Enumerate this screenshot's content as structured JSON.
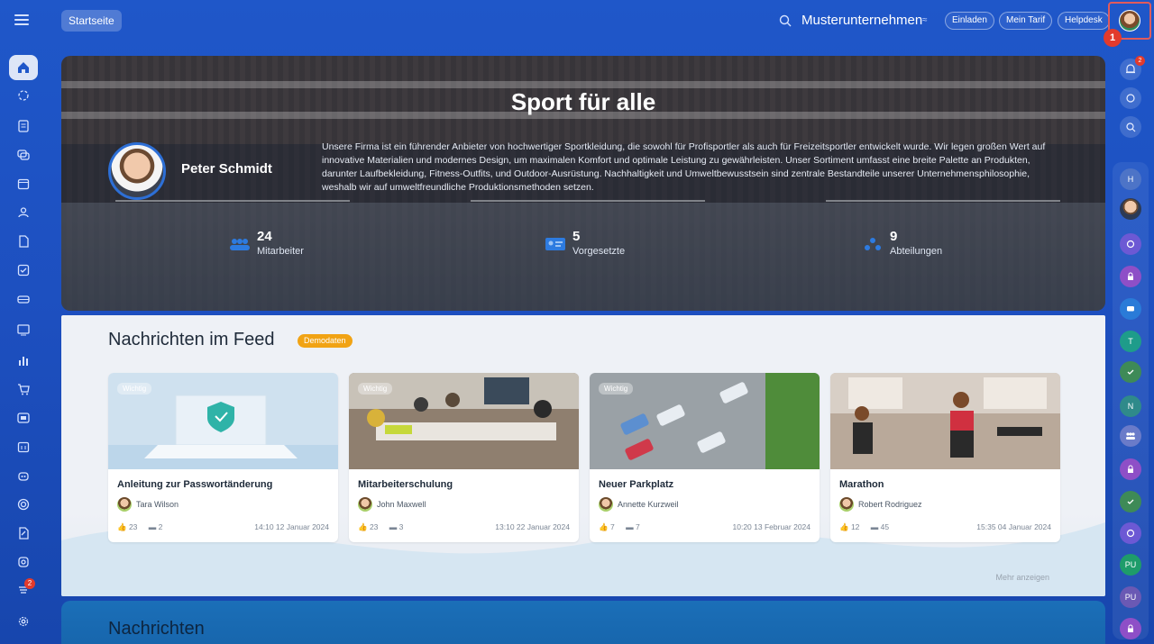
{
  "topbar": {
    "home_label": "Startseite",
    "company_name": "Musterunternehmen",
    "swap_symbol": "≈",
    "buttons": [
      "Einladen",
      "Mein Tarif",
      "Helpdesk"
    ],
    "marker": "1"
  },
  "left_nav": {
    "items": [
      "home-icon",
      "activity-icon",
      "tasks-icon",
      "chat-icon",
      "calendar-icon",
      "groups-icon",
      "documents-icon",
      "checklist-icon",
      "drive-icon",
      "presentation-icon",
      "analytics-icon",
      "shop-icon",
      "crm-icon",
      "scheduler-icon",
      "robot-icon",
      "target-icon",
      "sign-icon",
      "marketplace-icon",
      "sites-icon",
      "settings-icon"
    ],
    "badge": "2"
  },
  "right_nav": {
    "notif_badge": "2",
    "bubbles": [
      "H",
      "",
      "",
      "",
      "",
      "",
      "T",
      "",
      "N",
      "",
      "",
      "",
      "",
      "PU",
      "PU",
      ""
    ]
  },
  "hero": {
    "title": "Sport für alle",
    "person_name": "Peter Schmidt",
    "description": "Unsere Firma ist ein führender Anbieter von hochwertiger Sportkleidung, die sowohl für Profisportler als auch für Freizeitsportler entwickelt wurde. Wir legen großen Wert auf innovative Materialien und modernes Design, um maximalen Komfort und optimale Leistung zu gewährleisten. Unser Sortiment umfasst eine breite Palette an Produkten, darunter Laufbekleidung, Fitness-Outfits, und Outdoor-Ausrüstung. Nachhaltigkeit und Umweltbewusstsein sind zentrale Bestandteile unserer Unternehmensphilosophie, weshalb wir auf umweltfreundliche Produktionsmethoden setzen.",
    "stats": [
      {
        "value": "24",
        "label": "Mitarbeiter"
      },
      {
        "value": "5",
        "label": "Vorgesetzte"
      },
      {
        "value": "9",
        "label": "Abteilungen"
      }
    ]
  },
  "feed": {
    "title": "Nachrichten im Feed",
    "demo_badge": "Demodaten",
    "more_label": "Mehr anzeigen",
    "cards": [
      {
        "tag": "Wichtig",
        "title": "Anleitung zur Passwortänderung",
        "author": "Tara Wilson",
        "likes": "23",
        "comments": "2",
        "time": "14:10 12 Januar 2024"
      },
      {
        "tag": "Wichtig",
        "title": "Mitarbeiterschulung",
        "author": "John Maxwell",
        "likes": "23",
        "comments": "3",
        "time": "13:10 22 Januar 2024"
      },
      {
        "tag": "Wichtig",
        "title": "Neuer Parkplatz",
        "author": "Annette Kurzweil",
        "likes": "7",
        "comments": "7",
        "time": "10:20 13 Februar 2024"
      },
      {
        "tag": "",
        "title": "Marathon",
        "author": "Robert Rodriguez",
        "likes": "12",
        "comments": "45",
        "time": "15:35 04 Januar 2024"
      }
    ]
  },
  "news": {
    "title": "Nachrichten"
  }
}
